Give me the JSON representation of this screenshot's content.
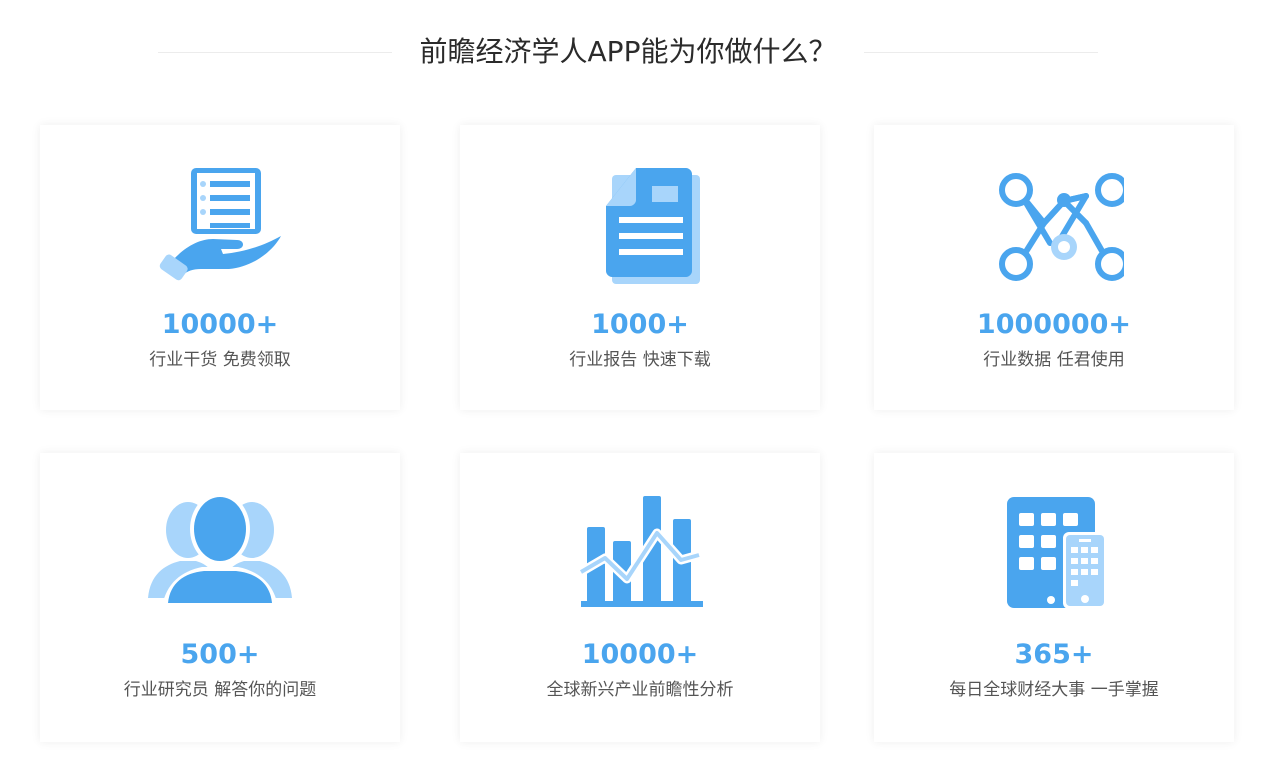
{
  "section": {
    "title": "前瞻经济学人APP能为你做什么？"
  },
  "colors": {
    "accent": "#4aa5ee",
    "accent_light": "#a8d5fb",
    "text": "#555555",
    "title": "#2b2b2b"
  },
  "features": [
    {
      "icon": "hand-document-icon",
      "value": "10000+",
      "desc": "行业干货 免费领取"
    },
    {
      "icon": "report-document-icon",
      "value": "1000+",
      "desc": "行业报告 快速下载"
    },
    {
      "icon": "data-network-icon",
      "value": "1000000+",
      "desc": "行业数据 任君使用"
    },
    {
      "icon": "researchers-group-icon",
      "value": "500+",
      "desc": "行业研究员 解答你的问题"
    },
    {
      "icon": "bar-chart-icon",
      "value": "10000+",
      "desc": "全球新兴产业前瞻性分析"
    },
    {
      "icon": "tablet-phone-icon",
      "value": "365+",
      "desc": "每日全球财经大事 一手掌握"
    }
  ]
}
